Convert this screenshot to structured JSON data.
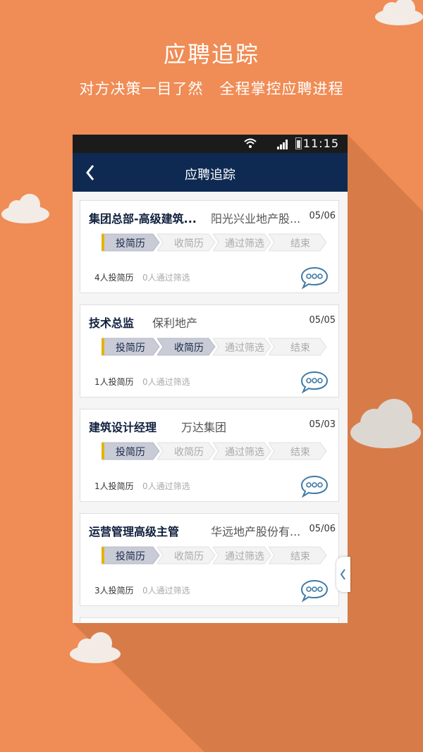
{
  "promo": {
    "title": "应聘追踪",
    "subtitle": "对方决策一目了然   全程掌控应聘进程"
  },
  "statusbar": {
    "time": "11:15",
    "icons": [
      "wifi-icon",
      "signal-icon",
      "battery-icon"
    ]
  },
  "navbar": {
    "title": "应聘追踪",
    "back_icon": "chevron-left-icon"
  },
  "step_labels": [
    "投简历",
    "收简历",
    "通过筛选",
    "结束"
  ],
  "colors": {
    "background": "#f08c55",
    "navbar": "#0e2a52",
    "accent": "#e3b20c",
    "active_step": "#c9cbd6",
    "dark_text": "#0e1f3d"
  },
  "applications": [
    {
      "job": "集团总部-高级建筑...",
      "company": "阳光兴业地产股...",
      "date": "05/06",
      "progress_steps": 1,
      "applied": "4人投简历",
      "passed": "0人通过筛选"
    },
    {
      "job": "技术总监",
      "company": "保利地产",
      "date": "05/05",
      "progress_steps": 2,
      "applied": "1人投简历",
      "passed": "0人通过筛选"
    },
    {
      "job": "建筑设计经理",
      "company": "万达集团",
      "date": "05/03",
      "progress_steps": 1,
      "applied": "1人投简历",
      "passed": "0人通过筛选"
    },
    {
      "job": "运营管理高级主管",
      "company": "华远地产股份有...",
      "date": "05/06",
      "progress_steps": 1,
      "applied": "3人投简历",
      "passed": "0人通过筛选"
    }
  ]
}
